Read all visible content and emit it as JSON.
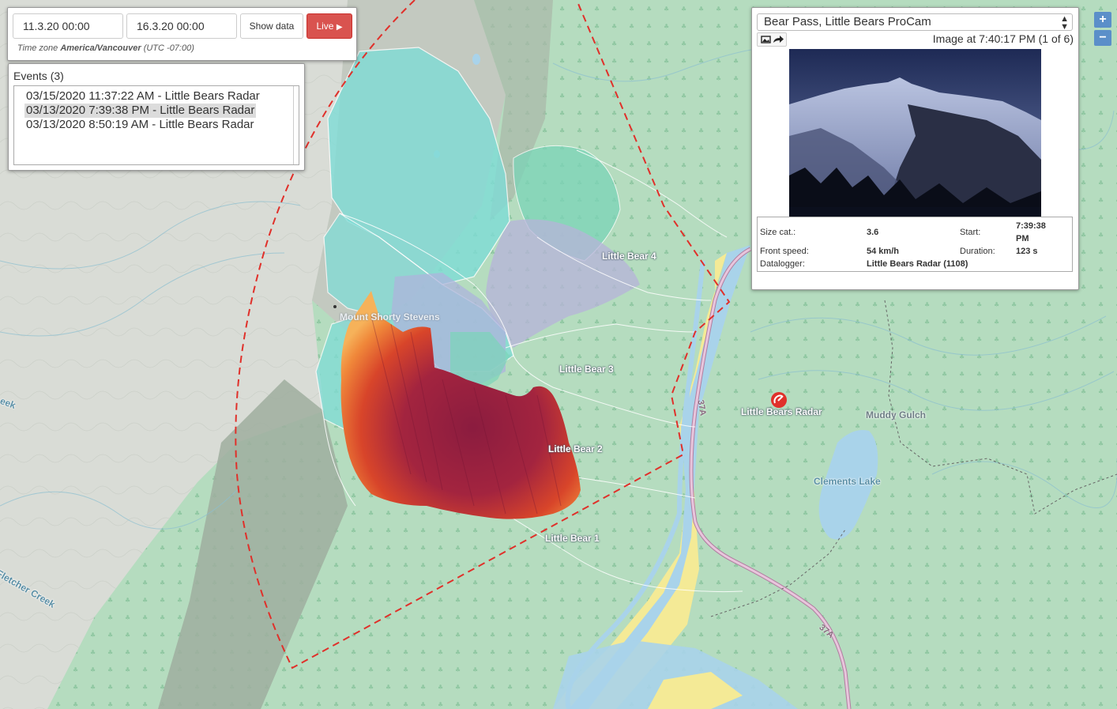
{
  "time_panel": {
    "start_date": "11.3.20 00:00",
    "end_date": "16.3.20 00:00",
    "show_data_label": "Show data",
    "live_label": "Live",
    "timezone_prefix": "Time zone",
    "timezone_name": "America/Vancouver",
    "timezone_offset": "(UTC -07:00)"
  },
  "events": {
    "title": "Events (3)",
    "items": [
      {
        "label": "03/15/2020 11:37:22 AM - Little Bears Radar",
        "selected": false
      },
      {
        "label": "03/13/2020 7:39:38 PM - Little Bears Radar",
        "selected": true
      },
      {
        "label": "03/13/2020 8:50:19 AM - Little Bears Radar",
        "selected": false
      }
    ]
  },
  "camera": {
    "selected_camera": "Bear Pass, Little Bears ProCam",
    "image_caption": "Image at 7:40:17 PM (1 of 6)",
    "tool_icons": [
      "image-icon",
      "share-icon"
    ],
    "stats": {
      "size_cat_label": "Size cat.:",
      "size_cat_value": "3.6",
      "start_label": "Start:",
      "start_value_line1": "7:39:38",
      "start_value_line2": "PM",
      "front_speed_label": "Front speed:",
      "front_speed_value": "54 km/h",
      "duration_label": "Duration:",
      "duration_value": "123 s",
      "datalogger_label": "Datalogger:",
      "datalogger_value": "Little Bears Radar (1108)"
    }
  },
  "zoom": {
    "in": "+",
    "out": "−"
  },
  "map": {
    "labels": {
      "little_bear_4": "Little Bear 4",
      "little_bear_3": "Little Bear 3",
      "little_bear_2": "Little Bear 2",
      "little_bear_1": "Little Bear 1",
      "mount_shorty_stevens": "Mount Shorty Stevens",
      "little_bears_radar": "Little Bears Radar",
      "muddy_gulch": "Muddy Gulch",
      "clements_lake": "Clements Lake",
      "fletcher_creek": "Fletcher Creek",
      "creek_edge": "eek",
      "road_37a_north": "37A",
      "road_37a_south": "37A"
    },
    "colors": {
      "forest": "#b5dcbf",
      "rock": "#d9dcd6",
      "slope_shadow": "#9fae9f",
      "water": "#a9d3ea",
      "sand": "#f4ea96",
      "road": "#d7a7c6",
      "radar_boundary": "#e0302a",
      "avalanche_cyan": "#7fdcd6",
      "avalanche_purple": "#b7b3da",
      "avalanche_green": "#7bd4b8",
      "detection_dark": "#8b1c3f",
      "detection_mid": "#d8452a",
      "detection_light": "#f6b25a"
    },
    "radar_icon": "radar-icon"
  }
}
